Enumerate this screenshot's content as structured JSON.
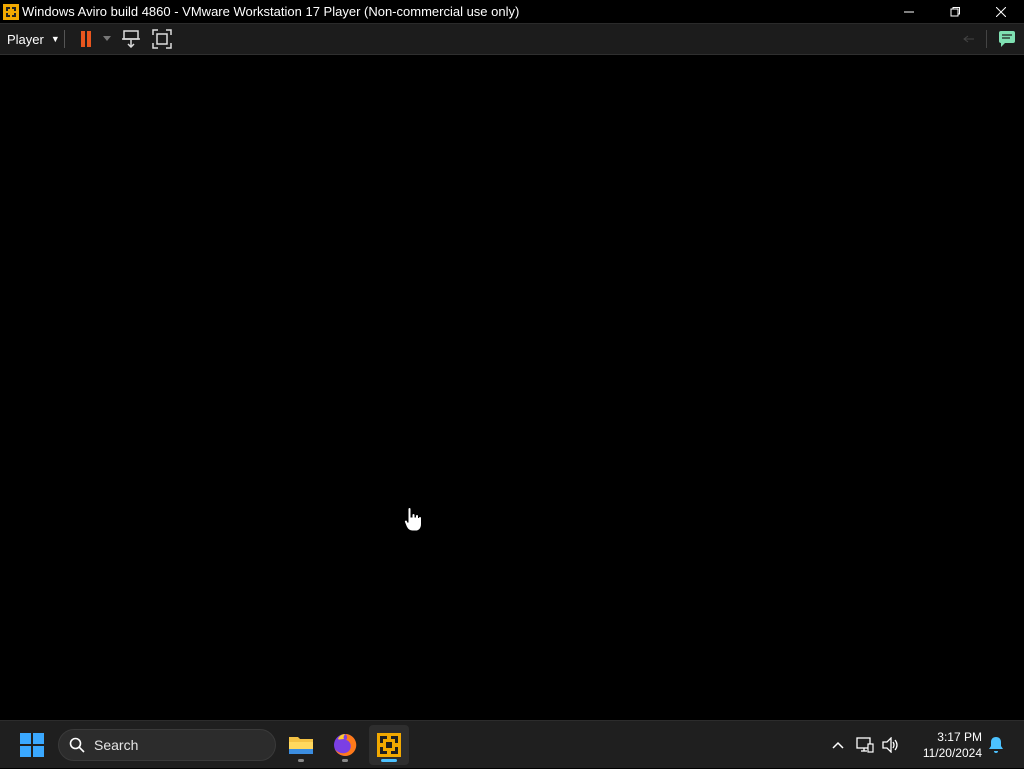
{
  "window": {
    "title": "Windows Aviro build 4860 - VMware Workstation 17 Player (Non-commercial use only)",
    "app_icon": "vmware-icon",
    "controls": [
      "minimize-icon",
      "restore-icon",
      "close-icon"
    ]
  },
  "toolbar": {
    "player_menu_label": "Player",
    "buttons": [
      "pause-icon",
      "dropdown-caret-icon",
      "send-ctrl-alt-del-icon",
      "fullscreen-icon"
    ],
    "right_icons": [
      "back-icon",
      "message-log-icon"
    ],
    "accent_color": "#e8561e",
    "message_icon_color": "#7fe0b2"
  },
  "taskbar": {
    "search_placeholder": "Search",
    "apps": [
      {
        "name": "file-explorer-icon",
        "active": false
      },
      {
        "name": "firefox-icon",
        "active": false
      },
      {
        "name": "vmware-player-icon",
        "active": true
      }
    ],
    "tray_icons": [
      "chevron-up-icon",
      "network-icon",
      "volume-icon",
      "notification-bell-icon"
    ],
    "time": "3:17 PM",
    "date": "11/20/2024",
    "accent_color": "#4cc2ff"
  }
}
